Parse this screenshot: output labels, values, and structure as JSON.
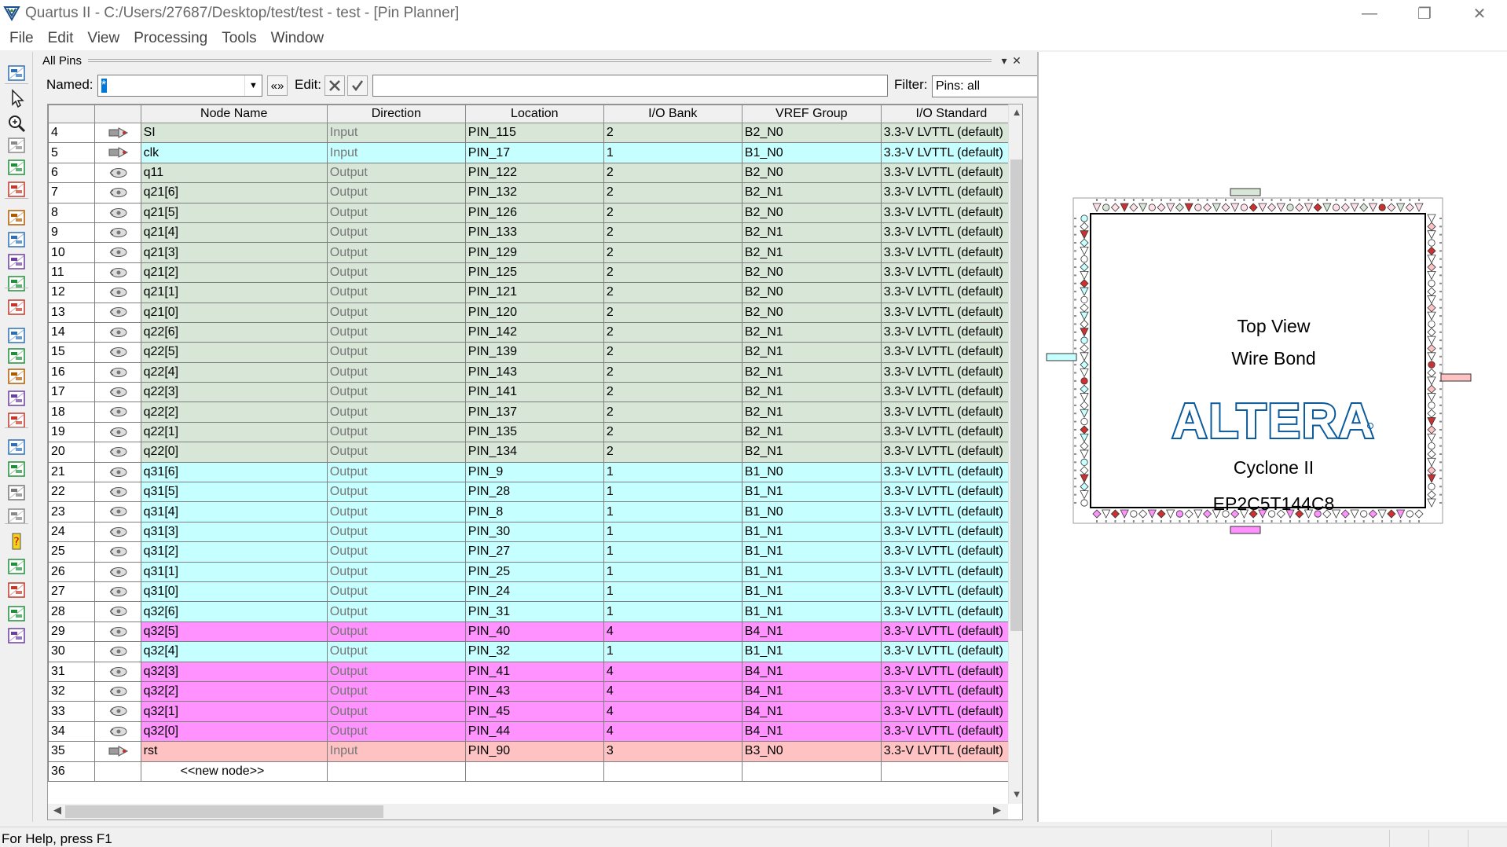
{
  "window": {
    "title": "Quartus II - C:/Users/27687/Desktop/test/test - test - [Pin Planner]",
    "minimize": "—",
    "restore": "❐",
    "close": "✕"
  },
  "menu": [
    "File",
    "Edit",
    "View",
    "Processing",
    "Tools",
    "Window"
  ],
  "panel": {
    "title": "All Pins",
    "named_label": "Named:",
    "named_value": "*",
    "named_options_btn": "«»",
    "edit_label": "Edit:",
    "filter_label": "Filter:",
    "filter_value": "Pins: all",
    "pin_menu": "▾",
    "pin_close": "✕"
  },
  "table": {
    "columns": [
      "",
      "",
      "Node Name",
      "Direction",
      "Location",
      "I/O Bank",
      "VREF Group",
      "I/O Standard"
    ],
    "rows": [
      {
        "n": "4",
        "name": "SI",
        "dir": "Input",
        "loc": "PIN_115",
        "bank": "2",
        "vref": "B2_N0",
        "std": "3.3-V LVTTL (default)"
      },
      {
        "n": "5",
        "name": "clk",
        "dir": "Input",
        "loc": "PIN_17",
        "bank": "1",
        "vref": "B1_N0",
        "std": "3.3-V LVTTL (default)"
      },
      {
        "n": "6",
        "name": "q11",
        "dir": "Output",
        "loc": "PIN_122",
        "bank": "2",
        "vref": "B2_N0",
        "std": "3.3-V LVTTL (default)"
      },
      {
        "n": "7",
        "name": "q21[6]",
        "dir": "Output",
        "loc": "PIN_132",
        "bank": "2",
        "vref": "B2_N1",
        "std": "3.3-V LVTTL (default)"
      },
      {
        "n": "8",
        "name": "q21[5]",
        "dir": "Output",
        "loc": "PIN_126",
        "bank": "2",
        "vref": "B2_N0",
        "std": "3.3-V LVTTL (default)"
      },
      {
        "n": "9",
        "name": "q21[4]",
        "dir": "Output",
        "loc": "PIN_133",
        "bank": "2",
        "vref": "B2_N1",
        "std": "3.3-V LVTTL (default)"
      },
      {
        "n": "10",
        "name": "q21[3]",
        "dir": "Output",
        "loc": "PIN_129",
        "bank": "2",
        "vref": "B2_N1",
        "std": "3.3-V LVTTL (default)"
      },
      {
        "n": "11",
        "name": "q21[2]",
        "dir": "Output",
        "loc": "PIN_125",
        "bank": "2",
        "vref": "B2_N0",
        "std": "3.3-V LVTTL (default)"
      },
      {
        "n": "12",
        "name": "q21[1]",
        "dir": "Output",
        "loc": "PIN_121",
        "bank": "2",
        "vref": "B2_N0",
        "std": "3.3-V LVTTL (default)"
      },
      {
        "n": "13",
        "name": "q21[0]",
        "dir": "Output",
        "loc": "PIN_120",
        "bank": "2",
        "vref": "B2_N0",
        "std": "3.3-V LVTTL (default)"
      },
      {
        "n": "14",
        "name": "q22[6]",
        "dir": "Output",
        "loc": "PIN_142",
        "bank": "2",
        "vref": "B2_N1",
        "std": "3.3-V LVTTL (default)"
      },
      {
        "n": "15",
        "name": "q22[5]",
        "dir": "Output",
        "loc": "PIN_139",
        "bank": "2",
        "vref": "B2_N1",
        "std": "3.3-V LVTTL (default)"
      },
      {
        "n": "16",
        "name": "q22[4]",
        "dir": "Output",
        "loc": "PIN_143",
        "bank": "2",
        "vref": "B2_N1",
        "std": "3.3-V LVTTL (default)"
      },
      {
        "n": "17",
        "name": "q22[3]",
        "dir": "Output",
        "loc": "PIN_141",
        "bank": "2",
        "vref": "B2_N1",
        "std": "3.3-V LVTTL (default)"
      },
      {
        "n": "18",
        "name": "q22[2]",
        "dir": "Output",
        "loc": "PIN_137",
        "bank": "2",
        "vref": "B2_N1",
        "std": "3.3-V LVTTL (default)"
      },
      {
        "n": "19",
        "name": "q22[1]",
        "dir": "Output",
        "loc": "PIN_135",
        "bank": "2",
        "vref": "B2_N1",
        "std": "3.3-V LVTTL (default)"
      },
      {
        "n": "20",
        "name": "q22[0]",
        "dir": "Output",
        "loc": "PIN_134",
        "bank": "2",
        "vref": "B2_N1",
        "std": "3.3-V LVTTL (default)"
      },
      {
        "n": "21",
        "name": "q31[6]",
        "dir": "Output",
        "loc": "PIN_9",
        "bank": "1",
        "vref": "B1_N0",
        "std": "3.3-V LVTTL (default)"
      },
      {
        "n": "22",
        "name": "q31[5]",
        "dir": "Output",
        "loc": "PIN_28",
        "bank": "1",
        "vref": "B1_N1",
        "std": "3.3-V LVTTL (default)"
      },
      {
        "n": "23",
        "name": "q31[4]",
        "dir": "Output",
        "loc": "PIN_8",
        "bank": "1",
        "vref": "B1_N0",
        "std": "3.3-V LVTTL (default)"
      },
      {
        "n": "24",
        "name": "q31[3]",
        "dir": "Output",
        "loc": "PIN_30",
        "bank": "1",
        "vref": "B1_N1",
        "std": "3.3-V LVTTL (default)"
      },
      {
        "n": "25",
        "name": "q31[2]",
        "dir": "Output",
        "loc": "PIN_27",
        "bank": "1",
        "vref": "B1_N1",
        "std": "3.3-V LVTTL (default)"
      },
      {
        "n": "26",
        "name": "q31[1]",
        "dir": "Output",
        "loc": "PIN_25",
        "bank": "1",
        "vref": "B1_N1",
        "std": "3.3-V LVTTL (default)"
      },
      {
        "n": "27",
        "name": "q31[0]",
        "dir": "Output",
        "loc": "PIN_24",
        "bank": "1",
        "vref": "B1_N1",
        "std": "3.3-V LVTTL (default)"
      },
      {
        "n": "28",
        "name": "q32[6]",
        "dir": "Output",
        "loc": "PIN_31",
        "bank": "1",
        "vref": "B1_N1",
        "std": "3.3-V LVTTL (default)"
      },
      {
        "n": "29",
        "name": "q32[5]",
        "dir": "Output",
        "loc": "PIN_40",
        "bank": "4",
        "vref": "B4_N1",
        "std": "3.3-V LVTTL (default)"
      },
      {
        "n": "30",
        "name": "q32[4]",
        "dir": "Output",
        "loc": "PIN_32",
        "bank": "1",
        "vref": "B1_N1",
        "std": "3.3-V LVTTL (default)"
      },
      {
        "n": "31",
        "name": "q32[3]",
        "dir": "Output",
        "loc": "PIN_41",
        "bank": "4",
        "vref": "B4_N1",
        "std": "3.3-V LVTTL (default)"
      },
      {
        "n": "32",
        "name": "q32[2]",
        "dir": "Output",
        "loc": "PIN_43",
        "bank": "4",
        "vref": "B4_N1",
        "std": "3.3-V LVTTL (default)"
      },
      {
        "n": "33",
        "name": "q32[1]",
        "dir": "Output",
        "loc": "PIN_45",
        "bank": "4",
        "vref": "B4_N1",
        "std": "3.3-V LVTTL (default)"
      },
      {
        "n": "34",
        "name": "q32[0]",
        "dir": "Output",
        "loc": "PIN_44",
        "bank": "4",
        "vref": "B4_N1",
        "std": "3.3-V LVTTL (default)"
      },
      {
        "n": "35",
        "name": "rst",
        "dir": "Input",
        "loc": "PIN_90",
        "bank": "3",
        "vref": "B3_N0",
        "std": "3.3-V LVTTL (default)"
      }
    ],
    "new_row": {
      "n": "36",
      "name": "<<new node>>"
    }
  },
  "package": {
    "line1": "Top View",
    "line2": "Wire Bond",
    "brand": "ALTERA",
    "family": "Cyclone II",
    "device": "EP2C5T144C8",
    "colors": {
      "bank1": "#c6ffff",
      "bank2": "#d8e6d8",
      "bank3": "#ffc2c2",
      "bank4": "#ff92ff",
      "logo": "#0a5a9c"
    }
  },
  "status": {
    "help": "For Help, press F1"
  },
  "icons": {
    "input_pin": "input-pin-icon",
    "output_pin": "output-pin-icon"
  }
}
